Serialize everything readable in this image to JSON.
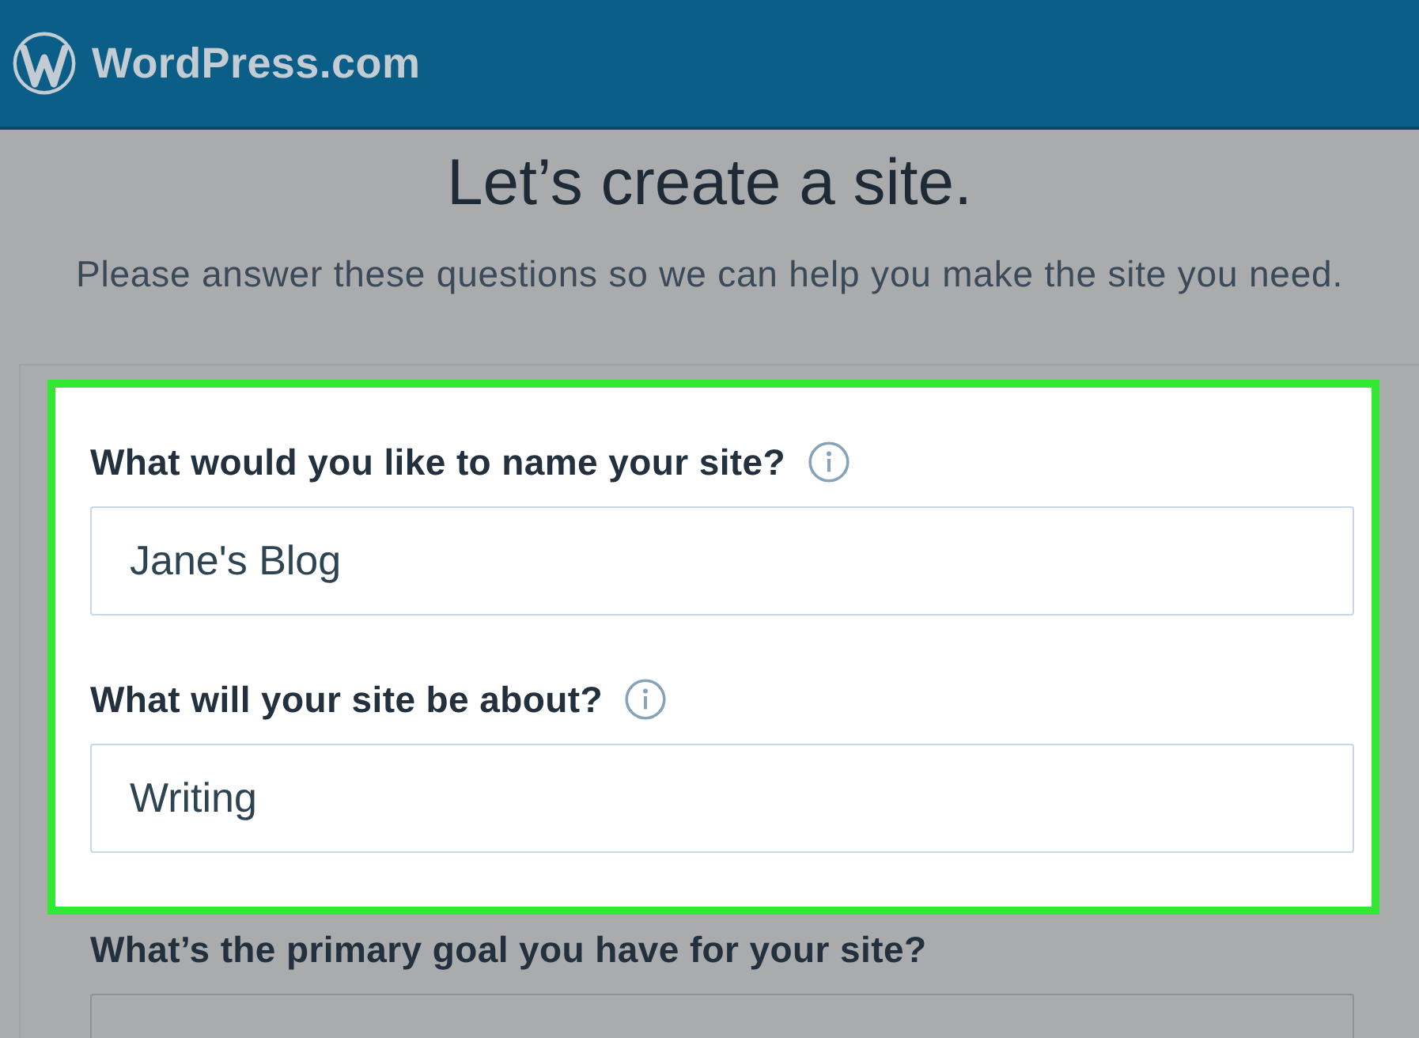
{
  "header": {
    "brand": "WordPress.com"
  },
  "intro": {
    "title": "Let’s create a site.",
    "subtitle": "Please answer these questions so we can help you make the site you need."
  },
  "form": {
    "questions": [
      {
        "label": "What would you like to name your site?",
        "info": true,
        "value": "Jane's Blog",
        "highlighted": true
      },
      {
        "label": "What will your site be about?",
        "info": true,
        "value": "Writing",
        "highlighted": true
      },
      {
        "label": "What’s the primary goal you have for your site?",
        "info": false,
        "highlighted": false
      }
    ]
  }
}
